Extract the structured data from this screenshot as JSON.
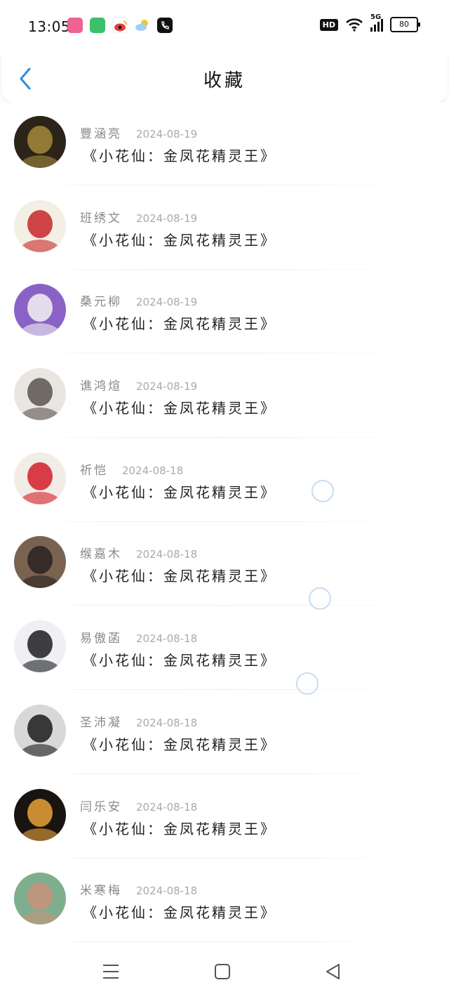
{
  "status_bar": {
    "time": "13:05",
    "app_icons": [
      {
        "name": "bilibili-app-icon",
        "color": "#f06292"
      },
      {
        "name": "green-app-icon",
        "color": "#3dbf6b"
      },
      {
        "name": "weibo-app-icon",
        "color": "#f5c23c"
      },
      {
        "name": "weather-app-icon",
        "color": "#7fc0f0"
      },
      {
        "name": "phone-app-icon",
        "color": "#111111"
      }
    ],
    "hd_label": "HD",
    "network_label": "5G",
    "battery": "80"
  },
  "header": {
    "title": "收藏",
    "accent_color": "#2d8fe0"
  },
  "favorites": [
    {
      "name": "豐涵亮",
      "date": "2024-08-19",
      "text": "《小花仙：金凤花精灵王》",
      "avatar_colors": [
        "#2c2418",
        "#a58a3a"
      ]
    },
    {
      "name": "班绣文",
      "date": "2024-08-19",
      "text": "《小花仙：金凤花精灵王》",
      "avatar_colors": [
        "#f3efe4",
        "#c8262b"
      ]
    },
    {
      "name": "桑元柳",
      "date": "2024-08-19",
      "text": "《小花仙：金凤花精灵王》",
      "avatar_colors": [
        "#8a62c6",
        "#f2f2f2"
      ]
    },
    {
      "name": "谯鸿煊",
      "date": "2024-08-19",
      "text": "《小花仙：金凤花精灵王》",
      "avatar_colors": [
        "#e9e6e2",
        "#5a5450"
      ]
    },
    {
      "name": "祈恺",
      "date": "2024-08-18",
      "text": "《小花仙：金凤花精灵王》",
      "avatar_colors": [
        "#f2ece6",
        "#d31f2a"
      ]
    },
    {
      "name": "缑嘉木",
      "date": "2024-08-18",
      "text": "《小花仙：金凤花精灵王》",
      "avatar_colors": [
        "#7a6251",
        "#2a2220"
      ]
    },
    {
      "name": "易傲菡",
      "date": "2024-08-18",
      "text": "《小花仙：金凤花精灵王》",
      "avatar_colors": [
        "#eef0f3",
        "#1d1d22"
      ]
    },
    {
      "name": "圣沛凝",
      "date": "2024-08-18",
      "text": "《小花仙：金凤花精灵王》",
      "avatar_colors": [
        "#d8d8d8",
        "#1c1c1c"
      ]
    },
    {
      "name": "闫乐安",
      "date": "2024-08-18",
      "text": "《小花仙：金凤花精灵王》",
      "avatar_colors": [
        "#1a1410",
        "#e8a23a"
      ]
    },
    {
      "name": "米寒梅",
      "date": "2024-08-18",
      "text": "《小花仙：金凤花精灵王》",
      "avatar_colors": [
        "#7fae8f",
        "#c9927a"
      ]
    }
  ],
  "nav_bar": {
    "buttons": [
      "menu-icon",
      "home-icon",
      "back-triangle-icon"
    ]
  }
}
